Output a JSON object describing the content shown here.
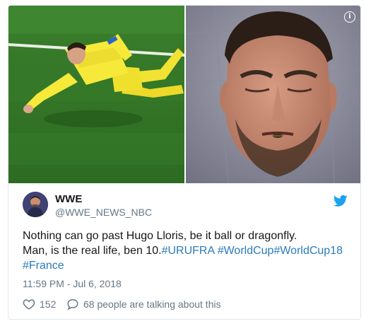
{
  "tweet": {
    "display_name": "WWE",
    "handle": "@WWE_NEWS_NBC",
    "text_line1": "Nothing can go past Hugo Lloris, be it ball or dragonfly.",
    "text_line2_prefix": "Man, is the real life, ben 10.",
    "hashtags": [
      "#URUFRA",
      "#WorldCup",
      "#WorldCup18",
      "#France"
    ],
    "timestamp": "11:59 PM - Jul 6, 2018",
    "like_count": "152",
    "talking_text": "68 people are talking about this"
  },
  "media": {
    "left_image": "goalkeeper-diving-save-photo",
    "right_image": "goalkeeper-closeup-with-dragonfly-photo"
  },
  "icons": {
    "info": "info-icon",
    "bird": "twitter-bird-icon",
    "like": "heart-icon",
    "reply": "comment-icon"
  },
  "colors": {
    "link": "#2b7bb9",
    "secondary_text": "#657786",
    "twitter_blue": "#1da1f2",
    "border": "#e1e8ed"
  }
}
